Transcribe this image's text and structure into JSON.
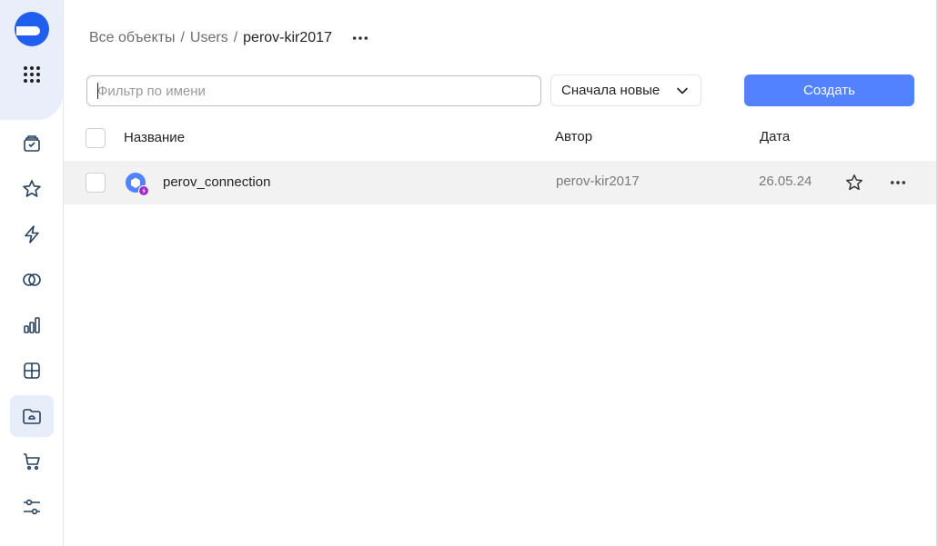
{
  "sidebar": {
    "items": [
      {
        "name": "collections-icon"
      },
      {
        "name": "favorites-star-icon"
      },
      {
        "name": "connections-bolt-icon"
      },
      {
        "name": "datasets-rings-icon"
      },
      {
        "name": "charts-bars-icon"
      },
      {
        "name": "dashboards-grid-icon"
      },
      {
        "name": "workbooks-folder-icon",
        "active": true
      },
      {
        "name": "marketplace-cart-icon"
      },
      {
        "name": "settings-sliders-icon"
      }
    ],
    "accent": "#1f5eef"
  },
  "breadcrumbs": {
    "items": [
      "Все объекты",
      "Users"
    ],
    "separator": "/",
    "current": "perov-kir2017"
  },
  "toolbar": {
    "filter_placeholder": "Фильтр по имени",
    "filter_value": "",
    "sort_label": "Сначала новые",
    "create_label": "Создать",
    "create_color": "#5282ff"
  },
  "table": {
    "columns": {
      "name": "Название",
      "author": "Автор",
      "date": "Дата"
    },
    "rows": [
      {
        "name": "perov_connection",
        "author": "perov-kir2017",
        "date": "26.05.24",
        "icon": "connection-icon"
      }
    ]
  }
}
